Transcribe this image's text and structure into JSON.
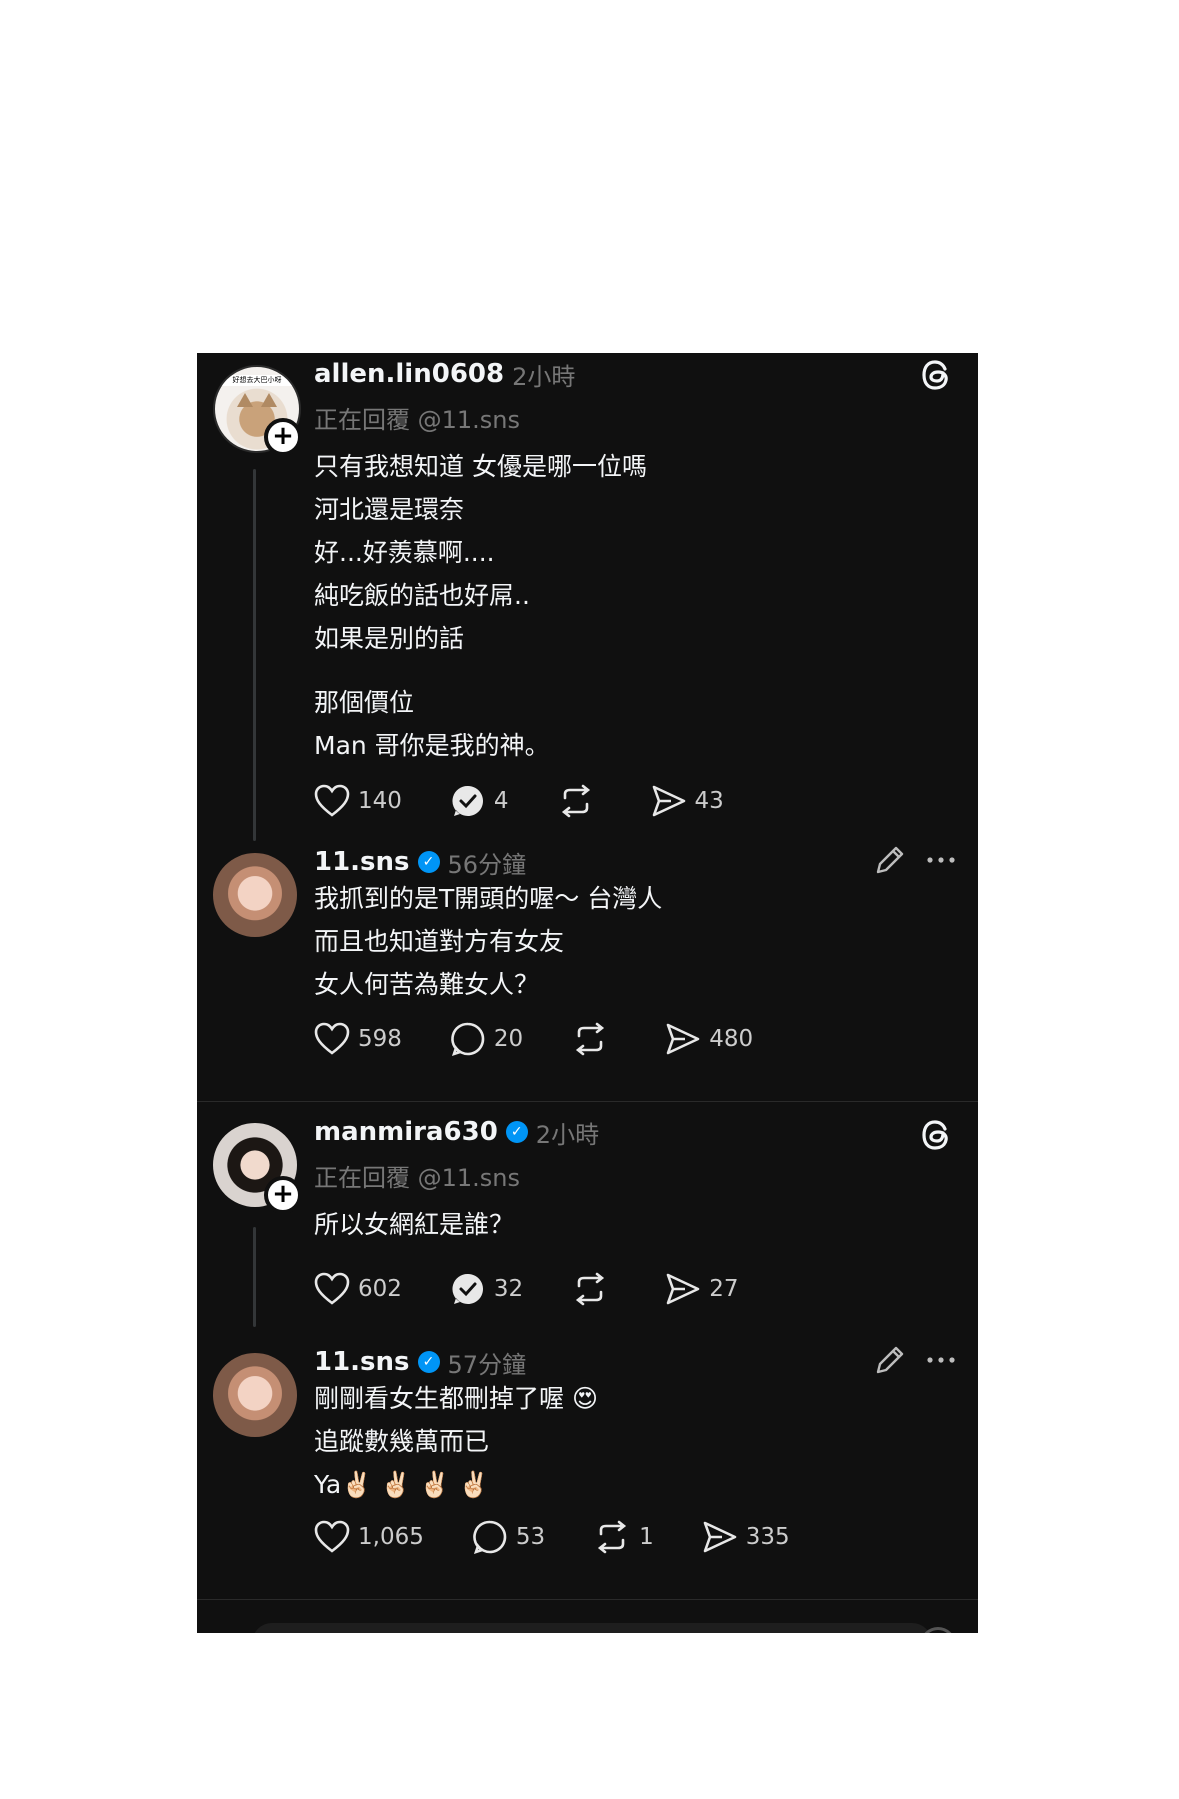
{
  "posts": [
    {
      "username": "allen.lin0608",
      "time": "2小時",
      "replying": "正在回覆 @11.sns",
      "avatar_caption": "好想去大巴小呀",
      "lines": "只有我想知道 女優是哪一位嗎\n河北還是環奈\n好...好羨慕啊....\n純吃飯的話也好屌..\n如果是別的話",
      "lines2": "那個價位\nMan 哥你是我的神。",
      "likes": "140",
      "replies": "4",
      "reposts": "",
      "shares": "43"
    },
    {
      "username": "11.sns",
      "time": "56分鐘",
      "lines": "我抓到的是T開頭的喔～ 台灣人\n而且也知道對方有女友\n女人何苦為難女人？",
      "likes": "598",
      "replies": "20",
      "reposts": "",
      "shares": "480"
    },
    {
      "username": "manmira630",
      "time": "2小時",
      "replying": "正在回覆 @11.sns",
      "lines": "所以女網紅是誰？",
      "likes": "602",
      "replies": "32",
      "reposts": "",
      "shares": "27"
    },
    {
      "username": "11.sns",
      "time": "57分鐘",
      "lines": "剛剛看女生都刪掉了喔 😍\n追蹤數幾萬而已\nYa✌🏻 ✌🏻 ✌🏻 ✌🏻",
      "likes": "1,065",
      "replies": "53",
      "reposts": "1",
      "shares": "335"
    }
  ],
  "icons": {
    "like": "heart-icon",
    "reply": "comment-icon",
    "reply_checked": "comment-check-icon",
    "repost": "repost-icon",
    "share": "send-icon",
    "threads": "threads-logo-icon",
    "edit": "pencil-icon",
    "more": "more-icon"
  },
  "colors": {
    "background": "#101010",
    "text": "#f3f5f7",
    "muted": "#777777",
    "verified": "#0095f6"
  }
}
